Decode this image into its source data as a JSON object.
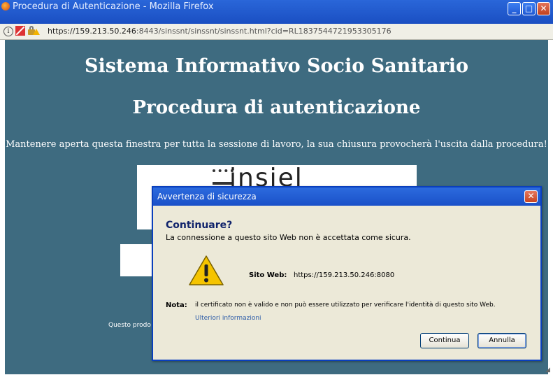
{
  "window": {
    "title": "Procedura di Autenticazione - Mozilla Firefox",
    "minimize_label": "_",
    "maximize_label": "□",
    "close_label": "✕"
  },
  "urlbar": {
    "info_glyph": "i",
    "url_host": "https://159.213.50.246",
    "url_rest": ":8443/sinssnt/sinssnt/sinssnt.html?cid=RL1837544721953305176"
  },
  "page": {
    "title": "Sistema Informativo Socio Sanitario",
    "subtitle": "Procedura di autenticazione",
    "notice": "Mantenere aperta questa finestra per tutta la sessione di lavoro, la sua chiusura provocherà l'uscita dalla procedura!",
    "logo_text": "insiel",
    "footer_text": "Questo prodo"
  },
  "dialog": {
    "title": "Avvertenza di sicurezza",
    "close_label": "✕",
    "heading": "Continuare?",
    "subheading": "La connessione a questo sito Web non è accettata come sicura.",
    "site_label": "Sito Web:",
    "site_value": "https://159.213.50.246:8080",
    "nota_label": "Nota:",
    "nota_text": "il certificato non è valido e non può essere utilizzato per verificare l'identità di questo sito Web.",
    "more_info_link": "Ulteriori informazioni",
    "continue_button": "Continua",
    "cancel_button": "Annulla"
  },
  "colors": {
    "page_background": "#3e6b80",
    "titlebar_blue": "#1a50c8",
    "dialog_background": "#ece9d8",
    "warning_yellow": "#f5c400"
  }
}
